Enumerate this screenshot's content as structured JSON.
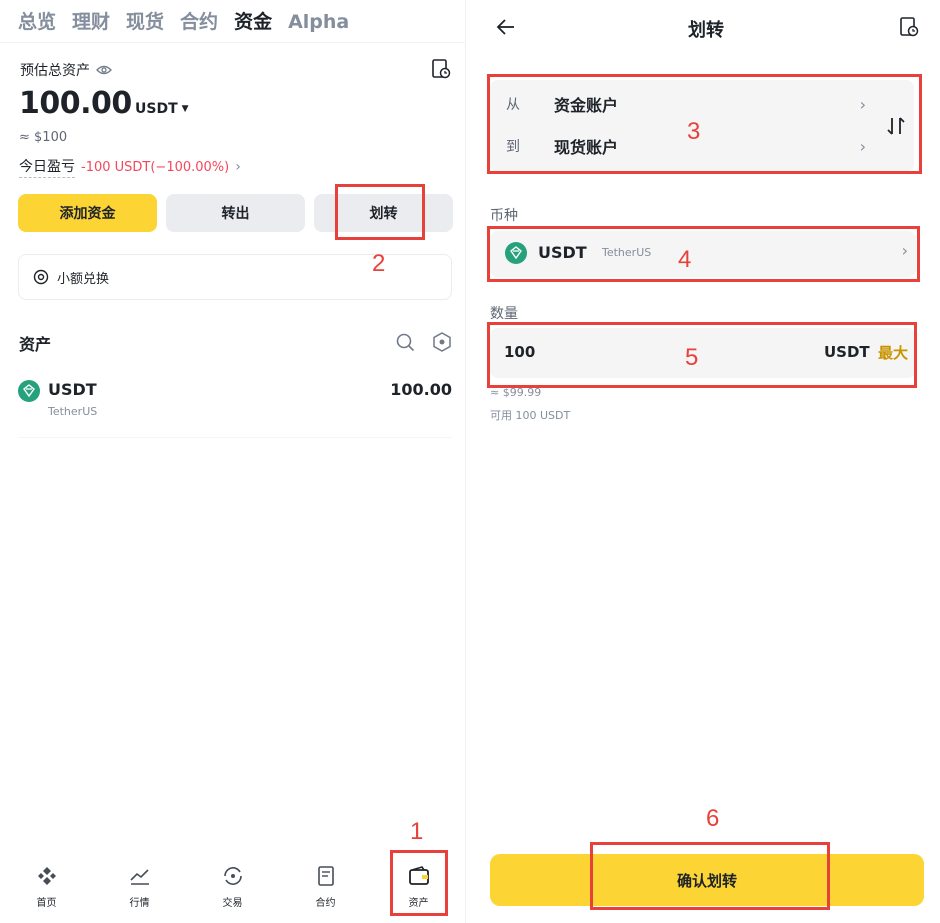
{
  "left": {
    "tabs": [
      "总览",
      "理财",
      "现货",
      "合约",
      "资金",
      "Alpha"
    ],
    "active_tab_index": 4,
    "estimated_label": "预估总资产",
    "total_amount": "100.00",
    "total_unit": "USDT",
    "approx_value": "≈ $100",
    "pnl_label": "今日盈亏",
    "pnl_value": "-100 USDT(−100.00%)",
    "buttons": {
      "add": "添加资金",
      "withdraw": "转出",
      "transfer": "划转"
    },
    "dust_label": "小额兑换",
    "assets_title": "资产",
    "asset": {
      "symbol": "USDT",
      "name": "TetherUS",
      "amount": "100.00"
    },
    "nav": [
      {
        "label": "首页",
        "icon": "home-icon"
      },
      {
        "label": "行情",
        "icon": "markets-icon"
      },
      {
        "label": "交易",
        "icon": "trade-icon"
      },
      {
        "label": "合约",
        "icon": "futures-icon"
      },
      {
        "label": "资产",
        "icon": "wallet-icon"
      }
    ]
  },
  "right": {
    "title": "划转",
    "from_label": "从",
    "from_value": "资金账户",
    "to_label": "到",
    "to_value": "现货账户",
    "coin_section": "币种",
    "coin_symbol": "USDT",
    "coin_name": "TetherUS",
    "amount_section": "数量",
    "amount_value": "100",
    "amount_unit": "USDT",
    "max_label": "最大",
    "amount_approx": "≈ $99.99",
    "available": "可用 100 USDT",
    "confirm_label": "确认划转"
  },
  "annotations": [
    "1",
    "2",
    "3",
    "4",
    "5",
    "6"
  ],
  "colors": {
    "accent": "#fcd535",
    "loss": "#f6465d",
    "annotation": "#e8413b",
    "tether": "#26a17b"
  }
}
